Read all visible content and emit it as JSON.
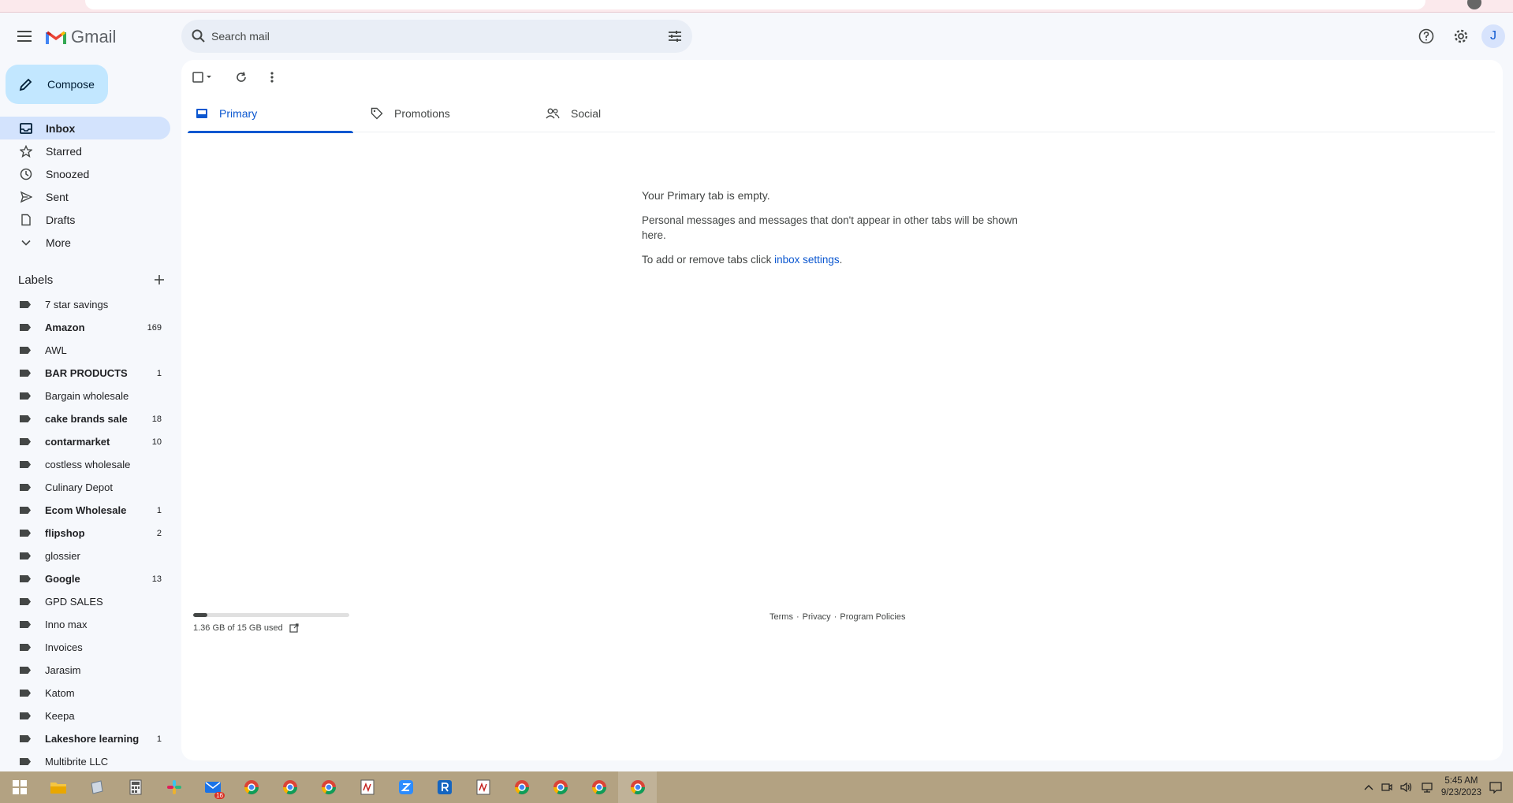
{
  "header": {
    "app_name": "Gmail",
    "search_placeholder": "Search mail",
    "account_initial": "J"
  },
  "compose_label": "Compose",
  "nav": [
    {
      "label": "Inbox",
      "icon": "inbox-icon",
      "active": true
    },
    {
      "label": "Starred",
      "icon": "star-icon"
    },
    {
      "label": "Snoozed",
      "icon": "clock-icon"
    },
    {
      "label": "Sent",
      "icon": "send-icon"
    },
    {
      "label": "Drafts",
      "icon": "draft-icon"
    },
    {
      "label": "More",
      "icon": "chevron-down-icon"
    }
  ],
  "labels_title": "Labels",
  "labels": [
    {
      "name": "7 star savings",
      "count": "",
      "bold": false
    },
    {
      "name": "Amazon",
      "count": "169",
      "bold": true
    },
    {
      "name": "AWL",
      "count": "",
      "bold": false
    },
    {
      "name": "BAR PRODUCTS",
      "count": "1",
      "bold": true
    },
    {
      "name": "Bargain wholesale",
      "count": "",
      "bold": false
    },
    {
      "name": "cake brands sale",
      "count": "18",
      "bold": true
    },
    {
      "name": "contarmarket",
      "count": "10",
      "bold": true
    },
    {
      "name": "costless wholesale",
      "count": "",
      "bold": false
    },
    {
      "name": "Culinary Depot",
      "count": "",
      "bold": false
    },
    {
      "name": "Ecom Wholesale",
      "count": "1",
      "bold": true
    },
    {
      "name": "flipshop",
      "count": "2",
      "bold": true
    },
    {
      "name": "glossier",
      "count": "",
      "bold": false
    },
    {
      "name": "Google",
      "count": "13",
      "bold": true
    },
    {
      "name": "GPD SALES",
      "count": "",
      "bold": false
    },
    {
      "name": "Inno max",
      "count": "",
      "bold": false
    },
    {
      "name": "Invoices",
      "count": "",
      "bold": false
    },
    {
      "name": "Jarasim",
      "count": "",
      "bold": false
    },
    {
      "name": "Katom",
      "count": "",
      "bold": false
    },
    {
      "name": "Keepa",
      "count": "",
      "bold": false
    },
    {
      "name": "Lakeshore learning",
      "count": "1",
      "bold": true
    },
    {
      "name": "Multibrite LLC",
      "count": "",
      "bold": false
    }
  ],
  "tabs": [
    {
      "label": "Primary",
      "icon": "inbox-tab-icon",
      "active": true
    },
    {
      "label": "Promotions",
      "icon": "tag-icon",
      "active": false
    },
    {
      "label": "Social",
      "icon": "people-icon",
      "active": false
    }
  ],
  "empty_state": {
    "title": "Your Primary tab is empty.",
    "body": "Personal messages and messages that don't appear in other tabs will be shown here.",
    "settings_prefix": "To add or remove tabs click ",
    "settings_link": "inbox settings",
    "settings_suffix": "."
  },
  "storage": {
    "text": "1.36 GB of 15 GB used",
    "used_fraction": 0.09
  },
  "footer": {
    "terms": "Terms",
    "privacy": "Privacy",
    "policies": "Program Policies",
    "separator": "·"
  },
  "taskbar": {
    "time": "5:45 AM",
    "date": "9/23/2023",
    "mail_badge": "16"
  },
  "colors": {
    "accent": "#0b57d0",
    "compose_bg": "#c2e7ff",
    "taskbar_bg": "#b3a282"
  }
}
